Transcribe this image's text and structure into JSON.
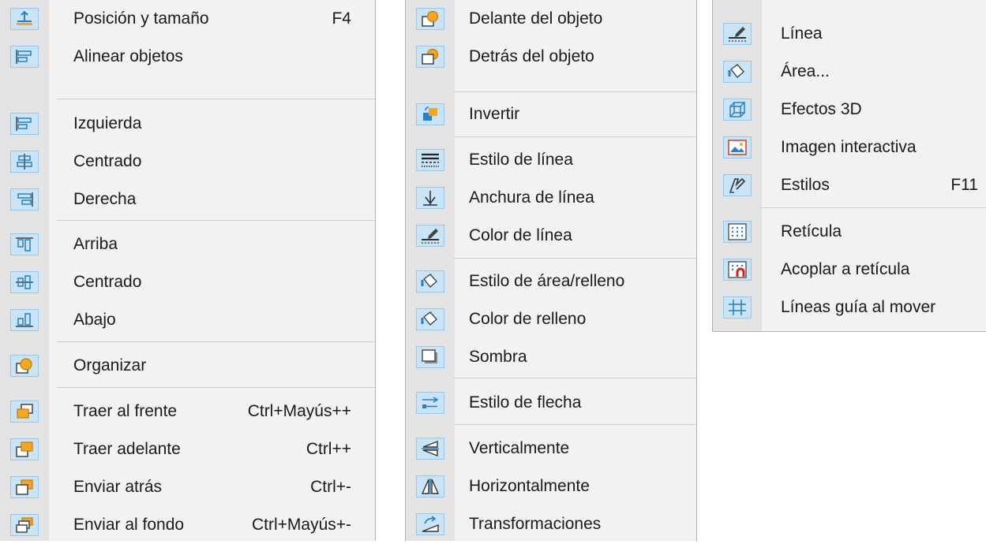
{
  "menu_left": {
    "items": [
      {
        "label": "Posición y tamaño",
        "shortcut": "F4"
      },
      {
        "label": "Alinear objetos",
        "shortcut": ""
      },
      {
        "label": "Izquierda",
        "shortcut": ""
      },
      {
        "label": "Centrado",
        "shortcut": ""
      },
      {
        "label": "Derecha",
        "shortcut": ""
      },
      {
        "label": "Arriba",
        "shortcut": ""
      },
      {
        "label": "Centrado",
        "shortcut": ""
      },
      {
        "label": "Abajo",
        "shortcut": ""
      },
      {
        "label": "Organizar",
        "shortcut": ""
      },
      {
        "label": "Traer al frente",
        "shortcut": "Ctrl+Mayús++"
      },
      {
        "label": "Traer adelante",
        "shortcut": "Ctrl++"
      },
      {
        "label": "Enviar atrás",
        "shortcut": "Ctrl+-"
      },
      {
        "label": "Enviar al fondo",
        "shortcut": "Ctrl+Mayús+-"
      }
    ]
  },
  "menu_middle": {
    "items": [
      {
        "label": "Delante del objeto"
      },
      {
        "label": "Detrás del objeto"
      },
      {
        "label": "Invertir"
      },
      {
        "label": "Estilo de línea"
      },
      {
        "label": "Anchura de línea"
      },
      {
        "label": "Color de línea"
      },
      {
        "label": "Estilo de área/relleno"
      },
      {
        "label": "Color de relleno"
      },
      {
        "label": "Sombra"
      },
      {
        "label": "Estilo de flecha"
      },
      {
        "label": "Verticalmente"
      },
      {
        "label": "Horizontalmente"
      },
      {
        "label": "Transformaciones"
      }
    ]
  },
  "menu_right": {
    "items": [
      {
        "label": "Línea",
        "shortcut": ""
      },
      {
        "label": "Área...",
        "shortcut": ""
      },
      {
        "label": "Efectos 3D",
        "shortcut": ""
      },
      {
        "label": "Imagen interactiva",
        "shortcut": ""
      },
      {
        "label": "Estilos",
        "shortcut": "F11"
      },
      {
        "label": "Retícula",
        "shortcut": ""
      },
      {
        "label": "Acoplar a retícula",
        "shortcut": ""
      },
      {
        "label": "Líneas guía al mover",
        "shortcut": ""
      }
    ]
  },
  "colors": {
    "icon_bg": "#c9e3f7",
    "icon_accent": "#f5a623",
    "icon_blue": "#2b7fc4",
    "menu_bg": "#f2f2f2"
  }
}
